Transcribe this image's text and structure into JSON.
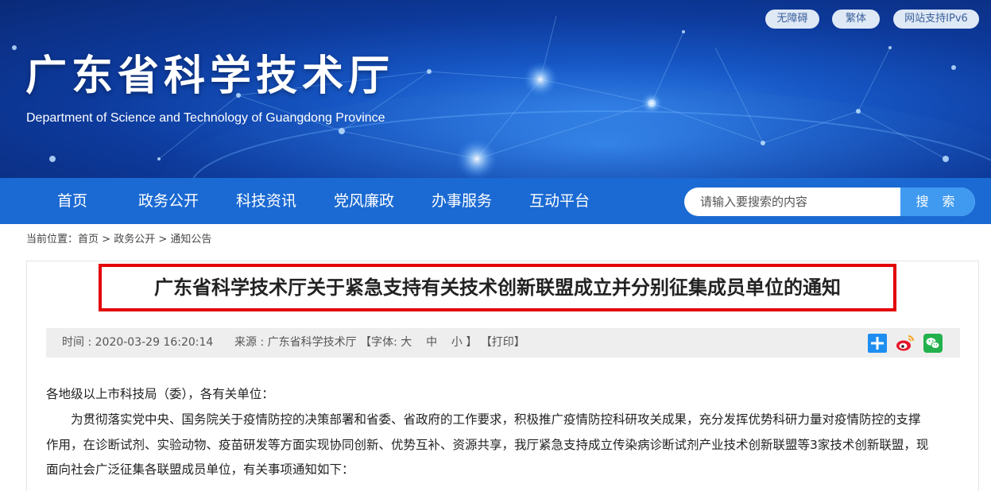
{
  "header": {
    "title": "广东省科学技术厅",
    "subtitle": "Department of Science and Technology of Guangdong Province",
    "top_links": [
      "无障碍",
      "繁体",
      "网站支持IPv6"
    ]
  },
  "nav": {
    "items": [
      "首页",
      "政务公开",
      "科技资讯",
      "党风廉政",
      "办事服务",
      "互动平台"
    ],
    "search_placeholder": "请输入要搜索的内容",
    "search_button": "搜 索"
  },
  "breadcrumb": {
    "prefix": "当前位置：",
    "items": [
      "首页",
      "政务公开",
      "通知公告"
    ],
    "separator": " > "
  },
  "article": {
    "title": "广东省科学技术厅关于紧急支持有关技术创新联盟成立并分别征集成员单位的通知",
    "meta": {
      "time_label": "时间 : ",
      "time": "2020-03-29 16:20:14",
      "source_label": "来源 : ",
      "source": "广东省科学技术厅",
      "font_open": "【字体: ",
      "font_large": "大",
      "font_medium": "中",
      "font_small": "小",
      "font_close": " 】",
      "print": "【打印】"
    },
    "share_icons": [
      "plus-share-icon",
      "weibo-icon",
      "wechat-icon"
    ],
    "paragraphs": [
      "各地级以上市科技局（委），各有关单位：",
      "为贯彻落实党中央、国务院关于疫情防控的决策部署和省委、省政府的工作要求，积极推广疫情防控科研攻关成果，充分发挥优势科研力量对疫情防控的支撑",
      "作用，在诊断试剂、实验动物、疫苗研发等方面实现协同创新、优势互补、资源共享，我厅紧急支持成立传染病诊断试剂产业技术创新联盟等3家技术创新联盟，现",
      "面向社会广泛征集各联盟成员单位，有关事项通知如下："
    ]
  },
  "colors": {
    "nav_bg": "#1b6ad3",
    "search_button_bg": "#3f9af0",
    "title_frame": "#e30000",
    "meta_bg": "#eeeeee"
  }
}
